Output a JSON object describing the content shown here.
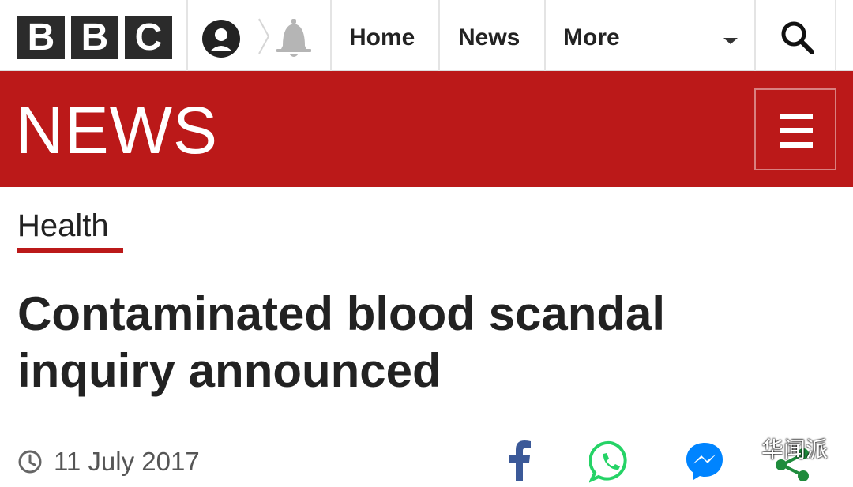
{
  "header": {
    "logo_letters": [
      "B",
      "B",
      "C"
    ],
    "nav": {
      "home": "Home",
      "news": "News",
      "more": "More"
    }
  },
  "banner": {
    "title": "NEWS"
  },
  "article": {
    "section": "Health",
    "headline": "Contaminated blood scandal inquiry announced",
    "date": "11 July 2017"
  },
  "share": {
    "icons": [
      "facebook-icon",
      "whatsapp-icon",
      "messenger-icon",
      "share-icon"
    ]
  },
  "watermark": {
    "text": "华闻派"
  },
  "colors": {
    "brand_red": "#bb1919",
    "logo_block": "#2b2b2b",
    "facebook": "#3b5998",
    "whatsapp": "#25d366",
    "messenger": "#0084ff",
    "share": "#1f8b3c"
  }
}
